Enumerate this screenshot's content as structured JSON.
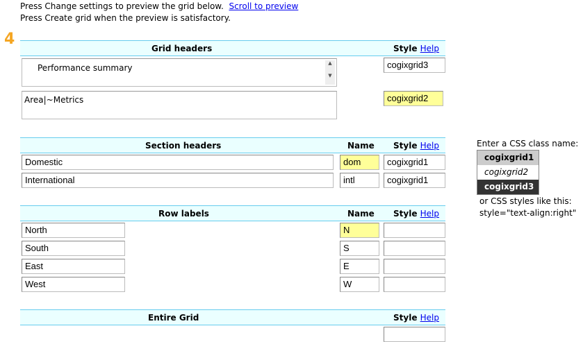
{
  "intro": {
    "line1": "Press Change settings to preview the grid below.",
    "scroll_link": "Scroll to preview",
    "line2": "Press Create grid when the preview is satisfactory."
  },
  "step_number": "4",
  "grid_headers": {
    "title": "Grid headers",
    "style_label": "Style",
    "help": "Help",
    "textarea1": "Performance summary",
    "textarea2": "Area|~Metrics",
    "style1": "cogixgrid3",
    "style2": "cogixgrid2"
  },
  "section_headers": {
    "title": "Section headers",
    "name_label": "Name",
    "style_label": "Style",
    "help": "Help",
    "rows": [
      {
        "label": "Domestic",
        "name": "dom",
        "style": "cogixgrid1"
      },
      {
        "label": "International",
        "name": "intl",
        "style": "cogixgrid1"
      }
    ]
  },
  "row_labels": {
    "title": "Row labels",
    "name_label": "Name",
    "style_label": "Style",
    "help": "Help",
    "rows": [
      {
        "label": "North",
        "name": "N",
        "style": ""
      },
      {
        "label": "South",
        "name": "S",
        "style": ""
      },
      {
        "label": "East",
        "name": "E",
        "style": ""
      },
      {
        "label": "West",
        "name": "W",
        "style": ""
      }
    ]
  },
  "entire_grid": {
    "title": "Entire Grid",
    "style_label": "Style",
    "help": "Help",
    "style": ""
  },
  "legend": {
    "intro": "Enter a CSS class name:",
    "classes": [
      "cogixgrid1",
      "cogixgrid2",
      "cogixgrid3"
    ],
    "outro1": "or CSS styles like this:",
    "outro2": "style=\"text-align:right\""
  }
}
